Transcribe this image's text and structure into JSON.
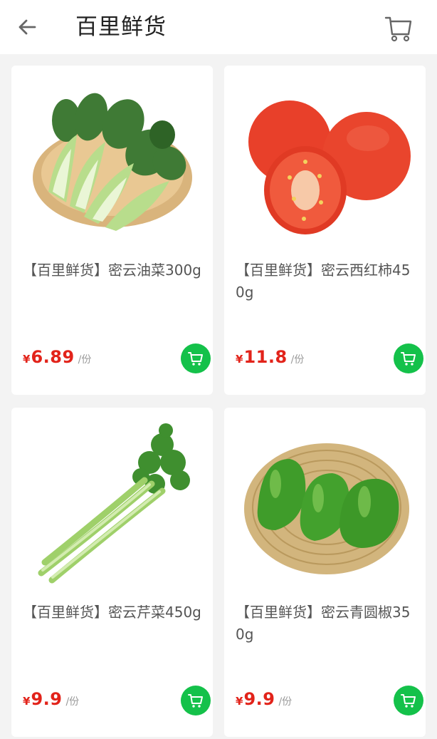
{
  "header": {
    "title": "百里鲜货",
    "back_icon": "arrow-left-icon",
    "cart_icon": "cart-icon"
  },
  "colors": {
    "price": "#e2231a",
    "add_button": "#14c14a",
    "background": "#f3f3f3"
  },
  "products": [
    {
      "name": "【百里鲜货】密云油菜300g",
      "currency": "¥",
      "price": "6.89",
      "unit": "/份",
      "image": "bok-choy"
    },
    {
      "name": "【百里鲜货】密云西红柿450g",
      "currency": "¥",
      "price": "11.8",
      "unit": "/份",
      "image": "tomatoes"
    },
    {
      "name": "【百里鲜货】密云芹菜450g",
      "currency": "¥",
      "price": "9.9",
      "unit": "/份",
      "image": "celery"
    },
    {
      "name": "【百里鲜货】密云青圆椒350g",
      "currency": "¥",
      "price": "9.9",
      "unit": "/份",
      "image": "green-peppers"
    }
  ]
}
